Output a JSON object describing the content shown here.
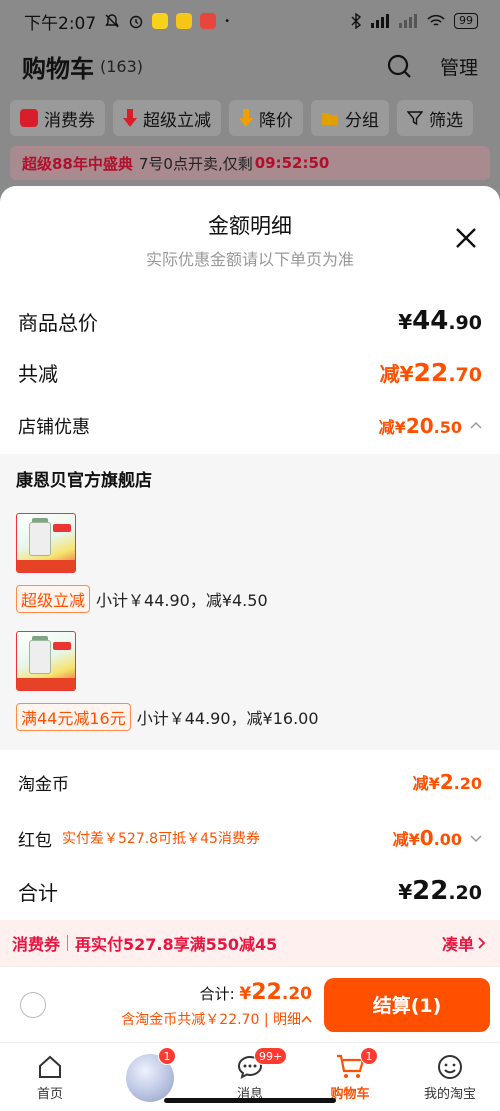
{
  "status_bar": {
    "time": "下午2:07",
    "battery": "99"
  },
  "background": {
    "title": "购物车",
    "count": "(163)",
    "manage": "管理",
    "chips": [
      {
        "label": "消费券",
        "icon": "coupon-icon",
        "color": "#d81e2a"
      },
      {
        "label": "超级立减",
        "icon": "arrow-down-icon",
        "color": "#d81e2a"
      },
      {
        "label": "降价",
        "icon": "price-drop-icon",
        "color": "#f0a000"
      },
      {
        "label": "分组",
        "icon": "folder-icon",
        "color": "#e0a000"
      },
      {
        "label": "筛选",
        "icon": "filter-icon",
        "color": "#333333"
      }
    ],
    "promo": {
      "tag": "超级88年中盛典",
      "text": "7号0点开卖,仅剩",
      "timer": "09:52:50"
    }
  },
  "sheet": {
    "title": "金额明细",
    "subtitle": "实际优惠金额请以下单页为准",
    "total": {
      "label": "商品总价",
      "yen": "¥",
      "int": "44",
      "dec": ".90"
    },
    "discount": {
      "label": "共减",
      "prefix": "减¥",
      "int": "22",
      "dec": ".70"
    },
    "shop": {
      "label": "店铺优惠",
      "prefix": "减¥",
      "int": "20",
      "dec": ".50"
    },
    "store_name": "康恩贝官方旗舰店",
    "items": [
      {
        "tag": "超级立减",
        "text": "小计￥44.90，减¥4.50"
      },
      {
        "tag": "满44元减16元",
        "text": "小计￥44.90，减¥16.00"
      }
    ],
    "coin": {
      "label": "淘金币",
      "prefix": "减¥",
      "int": "2",
      "dec": ".20"
    },
    "hongbao": {
      "label": "红包",
      "note": "实付差￥527.8可抵￥45消费券",
      "prefix": "减¥",
      "int": "0",
      "dec": ".00"
    },
    "sum": {
      "label": "合计",
      "yen": "¥",
      "int": "22",
      "dec": ".20"
    },
    "coupon_bar": {
      "left": "消费券",
      "middle": "再实付527.8享满550减45",
      "right": "凑单"
    }
  },
  "checkout": {
    "label": "合计:",
    "yen": "¥",
    "int": "22",
    "dec": ".20",
    "note": "含淘金币共减￥22.70",
    "detail": "明细",
    "button": "结算(1)"
  },
  "tabbar": [
    {
      "label": "首页",
      "icon": "home-icon"
    },
    {
      "label": "",
      "icon": "avatar",
      "badge": "1"
    },
    {
      "label": "消息",
      "icon": "message-icon",
      "badge": "99+"
    },
    {
      "label": "购物车",
      "icon": "cart-icon",
      "badge": "1",
      "active": true
    },
    {
      "label": "我的淘宝",
      "icon": "profile-icon"
    }
  ],
  "colors": {
    "accent": "#ff5000",
    "promo_red": "#e8153f"
  }
}
